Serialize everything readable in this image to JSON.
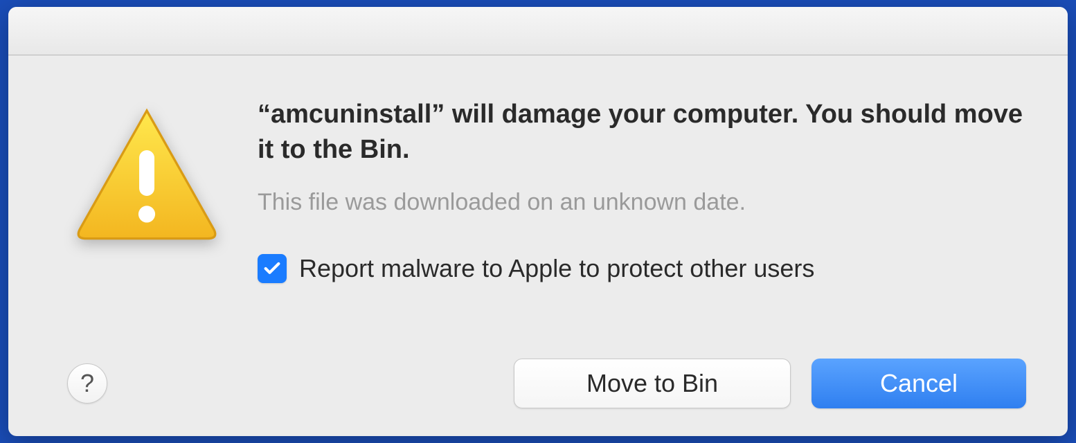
{
  "dialog": {
    "title": "“amcuninstall” will damage your computer. You should move it to the Bin.",
    "subtitle": "This file was downloaded on an unknown date.",
    "checkbox": {
      "checked": true,
      "label": "Report malware to Apple to protect other users"
    },
    "buttons": {
      "help": "?",
      "secondary": "Move to Bin",
      "primary": "Cancel"
    }
  },
  "icons": {
    "warning": "warning-triangle-icon",
    "checkmark": "checkmark-icon",
    "help": "help-icon"
  },
  "colors": {
    "accent": "#1a7cff",
    "primary_button": "#2f7ff0",
    "background": "#ececec"
  }
}
